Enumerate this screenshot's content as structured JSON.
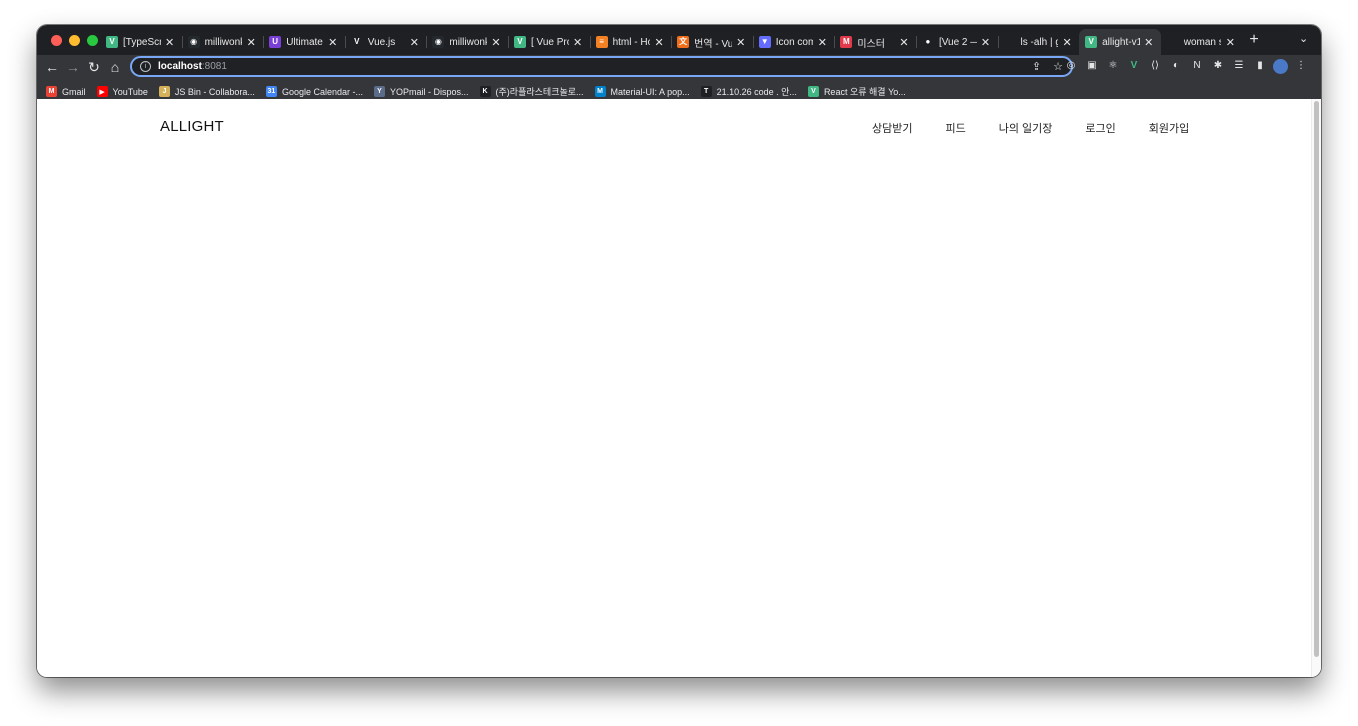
{
  "browser": {
    "tabs": [
      {
        "favicon": "vue-icon",
        "icon_text": "V",
        "icon_color": "#41b883",
        "title": "[TypeScript",
        "active": false
      },
      {
        "favicon": "github-icon",
        "icon_text": "◉",
        "icon_color": "#24292e",
        "title": "milliwonkim",
        "active": false
      },
      {
        "favicon": "ultimate-icon",
        "icon_text": "U",
        "icon_color": "#7a3fd6",
        "title": "Ultimate A",
        "active": false
      },
      {
        "favicon": "vue-icon",
        "icon_text": "V",
        "icon_color": "#1f2023",
        "title": "Vue.js",
        "active": false
      },
      {
        "favicon": "github-icon",
        "icon_text": "◉",
        "icon_color": "#24292e",
        "title": "milliwonkim",
        "active": false
      },
      {
        "favicon": "vue-icon",
        "icon_text": "V",
        "icon_color": "#41b883",
        "title": "[ Vue Proj",
        "active": false
      },
      {
        "favicon": "stackoverflow-icon",
        "icon_text": "≡",
        "icon_color": "#f48024",
        "title": "html - How",
        "active": false
      },
      {
        "favicon": "translate-icon",
        "icon_text": "文",
        "icon_color": "#f06d1a",
        "title": "번역 - Vue",
        "active": false
      },
      {
        "favicon": "vite-icon",
        "icon_text": "▼",
        "icon_color": "#646cff",
        "title": "Icon comp",
        "active": false
      },
      {
        "favicon": "misty-icon",
        "icon_text": "M",
        "icon_color": "#e23a4a",
        "title": "미스터",
        "active": false
      },
      {
        "favicon": "video-icon",
        "icon_text": "●",
        "icon_color": "#1f2023",
        "title": "[Vue 2 — ",
        "active": false
      },
      {
        "favicon": "blank-icon",
        "icon_text": "",
        "icon_color": "transparent",
        "title": "ls -alh | gr",
        "active": false
      },
      {
        "favicon": "vue-icon",
        "icon_text": "V",
        "icon_color": "#41b883",
        "title": "allight-v1",
        "active": true
      },
      {
        "favicon": "blank-icon",
        "icon_text": "",
        "icon_color": "transparent",
        "title": "woman st",
        "active": false
      }
    ],
    "address": {
      "host": "localhost",
      "port": ":8081"
    },
    "bookmarks": [
      {
        "icon": "gmail-icon",
        "icon_text": "M",
        "icon_color": "#ea4335",
        "label": "Gmail"
      },
      {
        "icon": "youtube-icon",
        "icon_text": "▶",
        "icon_color": "#ff0000",
        "label": "YouTube"
      },
      {
        "icon": "jsbin-icon",
        "icon_text": "J",
        "icon_color": "#d4b15a",
        "label": "JS Bin - Collabora..."
      },
      {
        "icon": "calendar-icon",
        "icon_text": "31",
        "icon_color": "#4285f4",
        "label": "Google Calendar -..."
      },
      {
        "icon": "yopmail-icon",
        "icon_text": "Y",
        "icon_color": "#5b6b8a",
        "label": "YOPmail - Dispos..."
      },
      {
        "icon": "bookmark-icon",
        "icon_text": "K",
        "icon_color": "#1f2023",
        "label": "(주)라플라스테크놀로..."
      },
      {
        "icon": "mui-icon",
        "icon_text": "M",
        "icon_color": "#0081cb",
        "label": "Material-UI: A pop..."
      },
      {
        "icon": "tistory-icon",
        "icon_text": "T",
        "icon_color": "#1f2023",
        "label": "21.10.26 code . 안..."
      },
      {
        "icon": "vue-icon",
        "icon_text": "V",
        "icon_color": "#41b883",
        "label": "React 오류 해결 Yo..."
      }
    ]
  },
  "page": {
    "logo": "ALLIGHT",
    "nav": [
      "상담받기",
      "피드",
      "나의 일기장",
      "로그인",
      "회원가입"
    ]
  }
}
